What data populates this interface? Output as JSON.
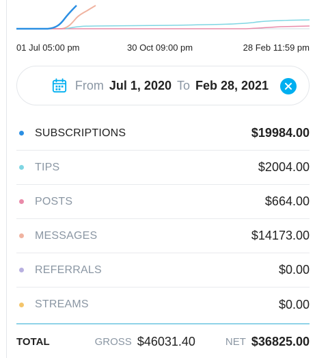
{
  "chart": {
    "x_ticks": [
      "01 Jul 05:00 pm",
      "30 Oct 09:00 pm",
      "28 Feb 11:59 pm"
    ],
    "series_colors": {
      "subscriptions": "#2b8fe3",
      "tips": "#7fd6e3",
      "posts": "#e98aa9",
      "messages": "#f0b3a0"
    }
  },
  "date_range": {
    "from_label": "From",
    "from_value": "Jul 1, 2020",
    "to_label": "To",
    "to_value": "Feb 28, 2021",
    "calendar_icon": "calendar-icon",
    "clear_icon": "close-icon"
  },
  "categories": [
    {
      "label": "SUBSCRIPTIONS",
      "value": "$19984.00",
      "color": "#2b8fe3",
      "active": true
    },
    {
      "label": "TIPS",
      "value": "$2004.00",
      "color": "#7fd6e3",
      "active": false
    },
    {
      "label": "POSTS",
      "value": "$664.00",
      "color": "#e98aa9",
      "active": false
    },
    {
      "label": "MESSAGES",
      "value": "$14173.00",
      "color": "#f0b3a0",
      "active": false
    },
    {
      "label": "REFERRALS",
      "value": "$0.00",
      "color": "#b8b0e0",
      "active": false
    },
    {
      "label": "STREAMS",
      "value": "$0.00",
      "color": "#f4c56b",
      "active": false
    }
  ],
  "total": {
    "label": "TOTAL",
    "gross_label": "GROSS",
    "gross_value": "$46031.40",
    "net_label": "NET",
    "net_value": "$36825.00"
  },
  "colors": {
    "accent": "#00aff0",
    "divider": "#8fd3e8"
  }
}
